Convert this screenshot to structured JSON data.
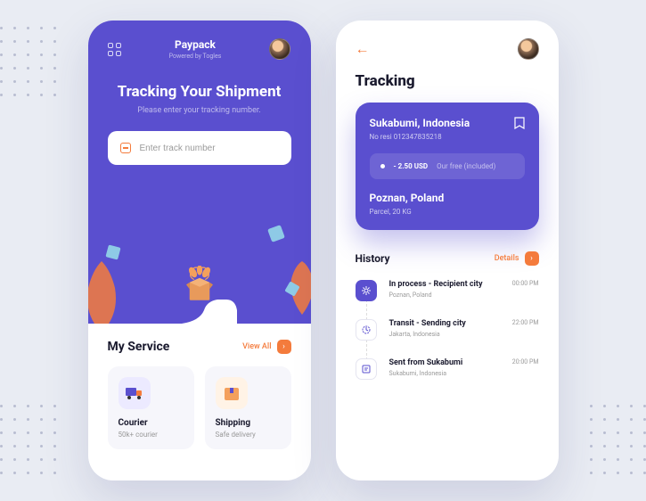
{
  "colors": {
    "primary": "#5a4fcf",
    "accent": "#f47b3c"
  },
  "phone1": {
    "brand": {
      "title": "Paypack",
      "subtitle": "Powered by Togles"
    },
    "hero": {
      "title": "Tracking Your Shipment",
      "subtitle": "Please enter your tracking number.",
      "placeholder": "Enter track number"
    },
    "services": {
      "title": "My Service",
      "viewAll": "View All",
      "cards": [
        {
          "name": "Courier",
          "sub": "50k+ courier"
        },
        {
          "name": "Shipping",
          "sub": "Safe delivery"
        }
      ]
    }
  },
  "phone2": {
    "title": "Tracking",
    "card": {
      "origin": "Sukabumi, Indonesia",
      "originSub": "No resi 012347835218",
      "price": "- 2.50 USD",
      "priceNote": "Our free (included)",
      "dest": "Poznan, Poland",
      "destSub": "Parcel, 20 KG"
    },
    "history": {
      "title": "History",
      "detailsLabel": "Details",
      "items": [
        {
          "title": "In process - Recipient city",
          "sub": "Poznan, Poland",
          "time": "00:00 PM"
        },
        {
          "title": "Transit - Sending city",
          "sub": "Jakarta, Indonesia",
          "time": "22:00 PM"
        },
        {
          "title": "Sent from Sukabumi",
          "sub": "Sukabumi, Indonesia",
          "time": "20:00 PM"
        }
      ]
    }
  }
}
